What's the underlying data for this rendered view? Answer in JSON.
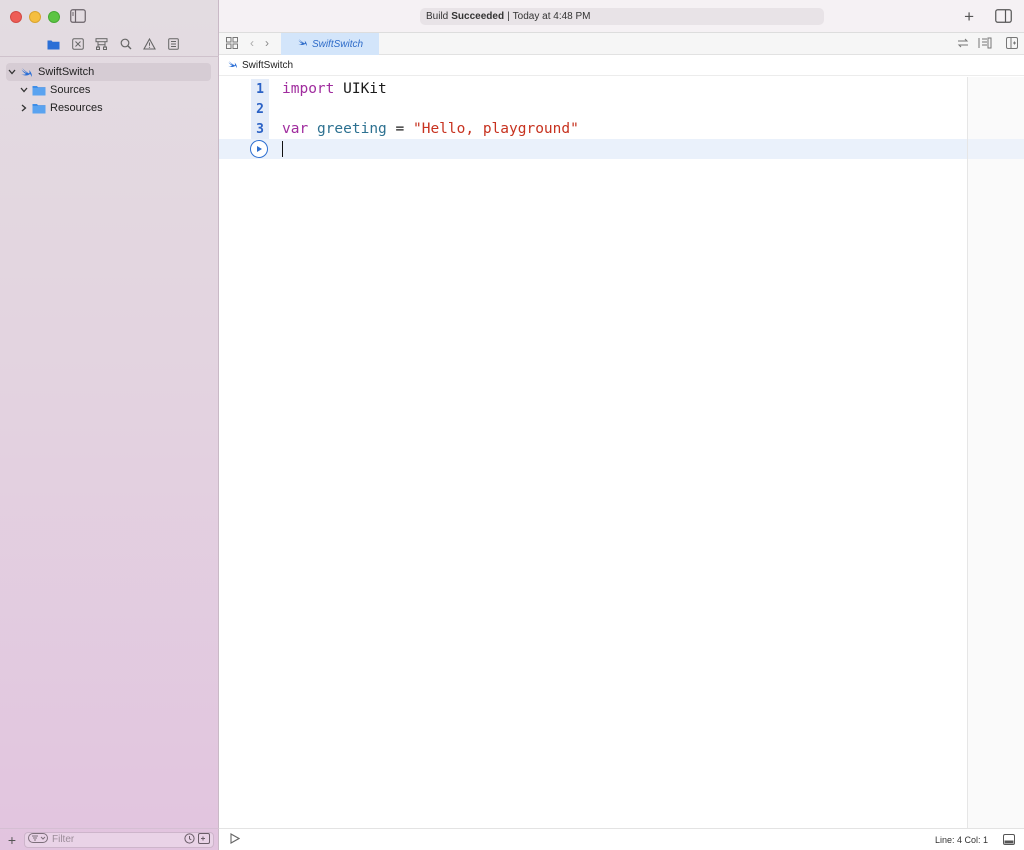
{
  "window": {
    "traffic_lights": [
      "close",
      "minimize",
      "zoom"
    ],
    "colors": {
      "close": "#ee5d56",
      "minimize": "#f5be3f",
      "zoom": "#5cc443",
      "accent": "#2f6cc9"
    }
  },
  "activity": {
    "prefix": "Build",
    "status": "Succeeded",
    "separator": "|",
    "time": "Today at 4:48 PM"
  },
  "navigator": {
    "icons": [
      "folder-icon",
      "source-control-icon",
      "symbol-icon",
      "find-icon",
      "issue-icon",
      "report-icon"
    ],
    "items": [
      {
        "label": "SwiftSwitch",
        "icon": "swift-icon",
        "expanded": true,
        "selected": true,
        "level": 0
      },
      {
        "label": "Sources",
        "icon": "folder-icon",
        "expanded": true,
        "selected": false,
        "level": 1
      },
      {
        "label": "Resources",
        "icon": "folder-icon",
        "expanded": false,
        "selected": false,
        "level": 1
      }
    ],
    "filter_placeholder": "Filter"
  },
  "tabs": [
    {
      "label": "SwiftSwitch",
      "active": true
    }
  ],
  "jumpbar": {
    "path": "SwiftSwitch"
  },
  "editor": {
    "lines": [
      {
        "number": "1",
        "tokens": [
          {
            "text": "import",
            "type": "keyword"
          },
          {
            "text": " UIKit",
            "type": "plain"
          }
        ]
      },
      {
        "number": "2",
        "tokens": []
      },
      {
        "number": "3",
        "tokens": [
          {
            "text": "var",
            "type": "keyword"
          },
          {
            "text": " ",
            "type": "plain"
          },
          {
            "text": "greeting",
            "type": "variable"
          },
          {
            "text": " = ",
            "type": "plain"
          },
          {
            "text": "\"Hello, playground\"",
            "type": "string"
          }
        ]
      }
    ],
    "current_line": "4"
  },
  "status": {
    "position": "Line: 4  Col: 1"
  }
}
